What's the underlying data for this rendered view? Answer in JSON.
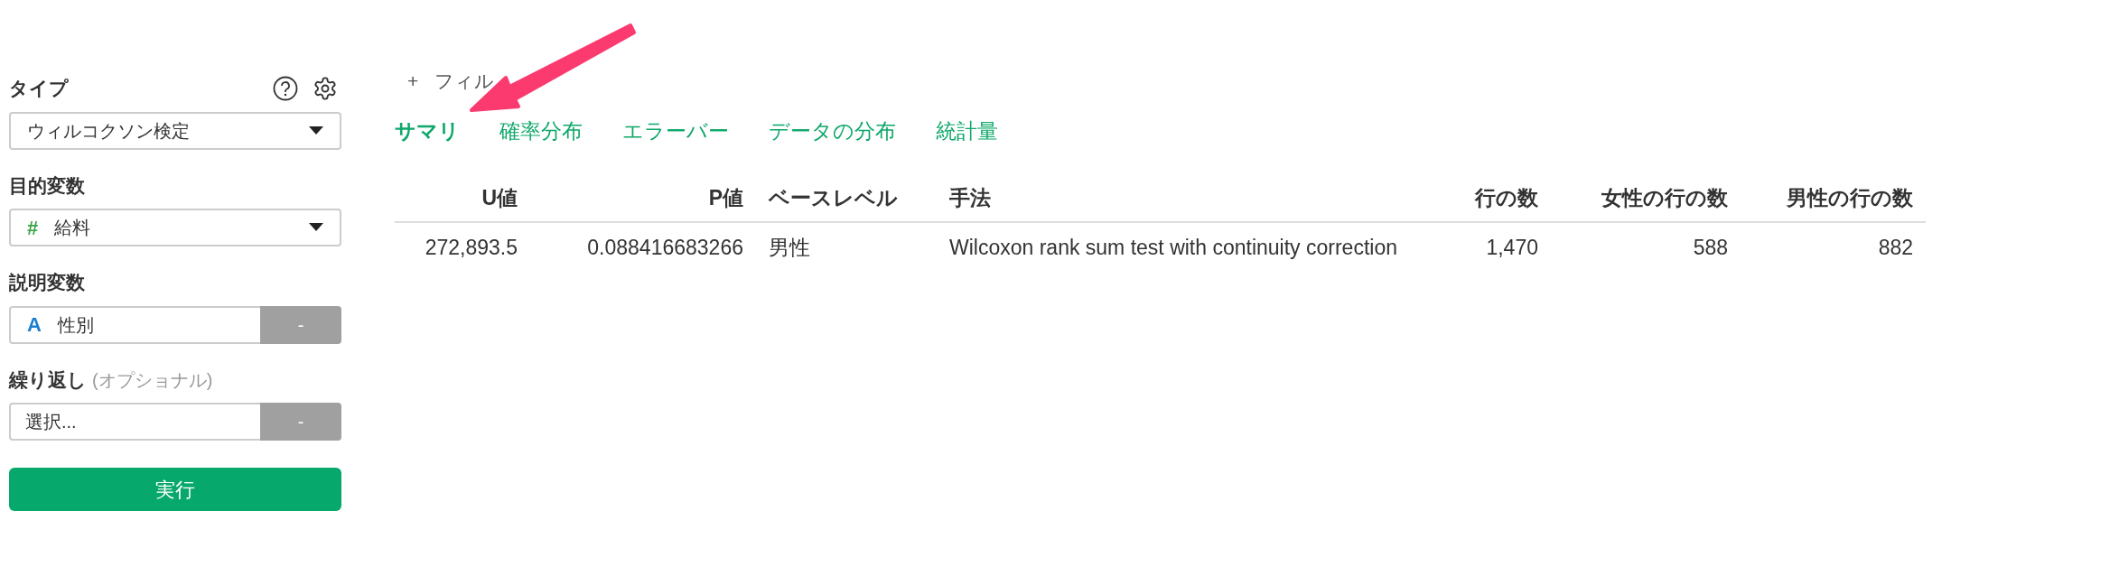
{
  "sidebar": {
    "type_label": "タイプ",
    "type_select": {
      "value": "ウィルコクソン検定"
    },
    "target_label": "目的変数",
    "target_select": {
      "value": "給料",
      "icon": "#"
    },
    "explanatory_label": "説明変数",
    "explanatory_field": {
      "value": "性別",
      "icon": "A",
      "button": "-"
    },
    "repeat_label": "繰り返し",
    "repeat_hint": "(オプショナル)",
    "repeat_field": {
      "placeholder": "選択...",
      "button": "-"
    },
    "run_button": "実行"
  },
  "filter": {
    "icon": "+",
    "label": "フィル"
  },
  "tabs": [
    {
      "label": "サマリ",
      "selected": true
    },
    {
      "label": "確率分布",
      "selected": false
    },
    {
      "label": "エラーバー",
      "selected": false
    },
    {
      "label": "データの分布",
      "selected": false
    },
    {
      "label": "統計量",
      "selected": false
    }
  ],
  "table": {
    "columns": [
      {
        "label": "U値"
      },
      {
        "label": "P値"
      },
      {
        "label": "ベースレベル"
      },
      {
        "label": "手法"
      },
      {
        "label": "行の数"
      },
      {
        "label": "女性の行の数"
      },
      {
        "label": "男性の行の数"
      }
    ],
    "rows": [
      [
        "272,893.5",
        "0.088416683266",
        "男性",
        "Wilcoxon rank sum test with continuity correction",
        "1,470",
        "588",
        "882"
      ]
    ]
  }
}
